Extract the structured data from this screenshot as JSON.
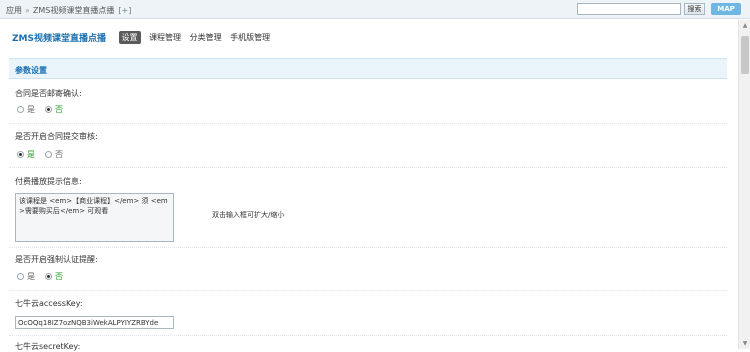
{
  "topbar": {
    "breadcrumb": [
      "应用",
      "ZMS视频课堂直播点播"
    ],
    "breadcrumb_sep": "»",
    "breadcrumb_toggle": "[+]",
    "search_placeholder": "",
    "search_button": "搜索",
    "map_button": "MAP"
  },
  "appnav": {
    "title": "ZMS视频课堂直播点播",
    "items": [
      "设置",
      "课程管理",
      "分类管理",
      "手机版管理"
    ],
    "active_index": 0
  },
  "section": {
    "title": "参数设置"
  },
  "fields": {
    "contract_email_confirm": {
      "label": "合同是否邮寄确认:",
      "options": [
        "是",
        "否"
      ],
      "selected": "否"
    },
    "contract_submit_review": {
      "label": "是否开启合同提交审核:",
      "options": [
        "是",
        "否"
      ],
      "selected": "是"
    },
    "paid_play_hint": {
      "label": "付费播放提示信息:",
      "value": "该课程是 <em>【商业课程】</em> 须 <em>需要购买后</em> 可观看",
      "hint": "双击输入框可扩大/缩小"
    },
    "force_auth_remind": {
      "label": "是否开启强制认证提醒:",
      "options": [
        "是",
        "否"
      ],
      "selected": "否"
    },
    "qiniu_access_key": {
      "label": "七牛云accessKey:",
      "value": "OcOQq18IZ7ozNQB3iWekALPYIYZRBYde"
    },
    "qiniu_secret_key": {
      "label": "七牛云secretKey:"
    }
  },
  "colors": {
    "accent": "#1a6fb0",
    "selected_green": "#2a9a2a",
    "section_bg": "#eaf4fb",
    "map_button": "#6fb7e3"
  }
}
